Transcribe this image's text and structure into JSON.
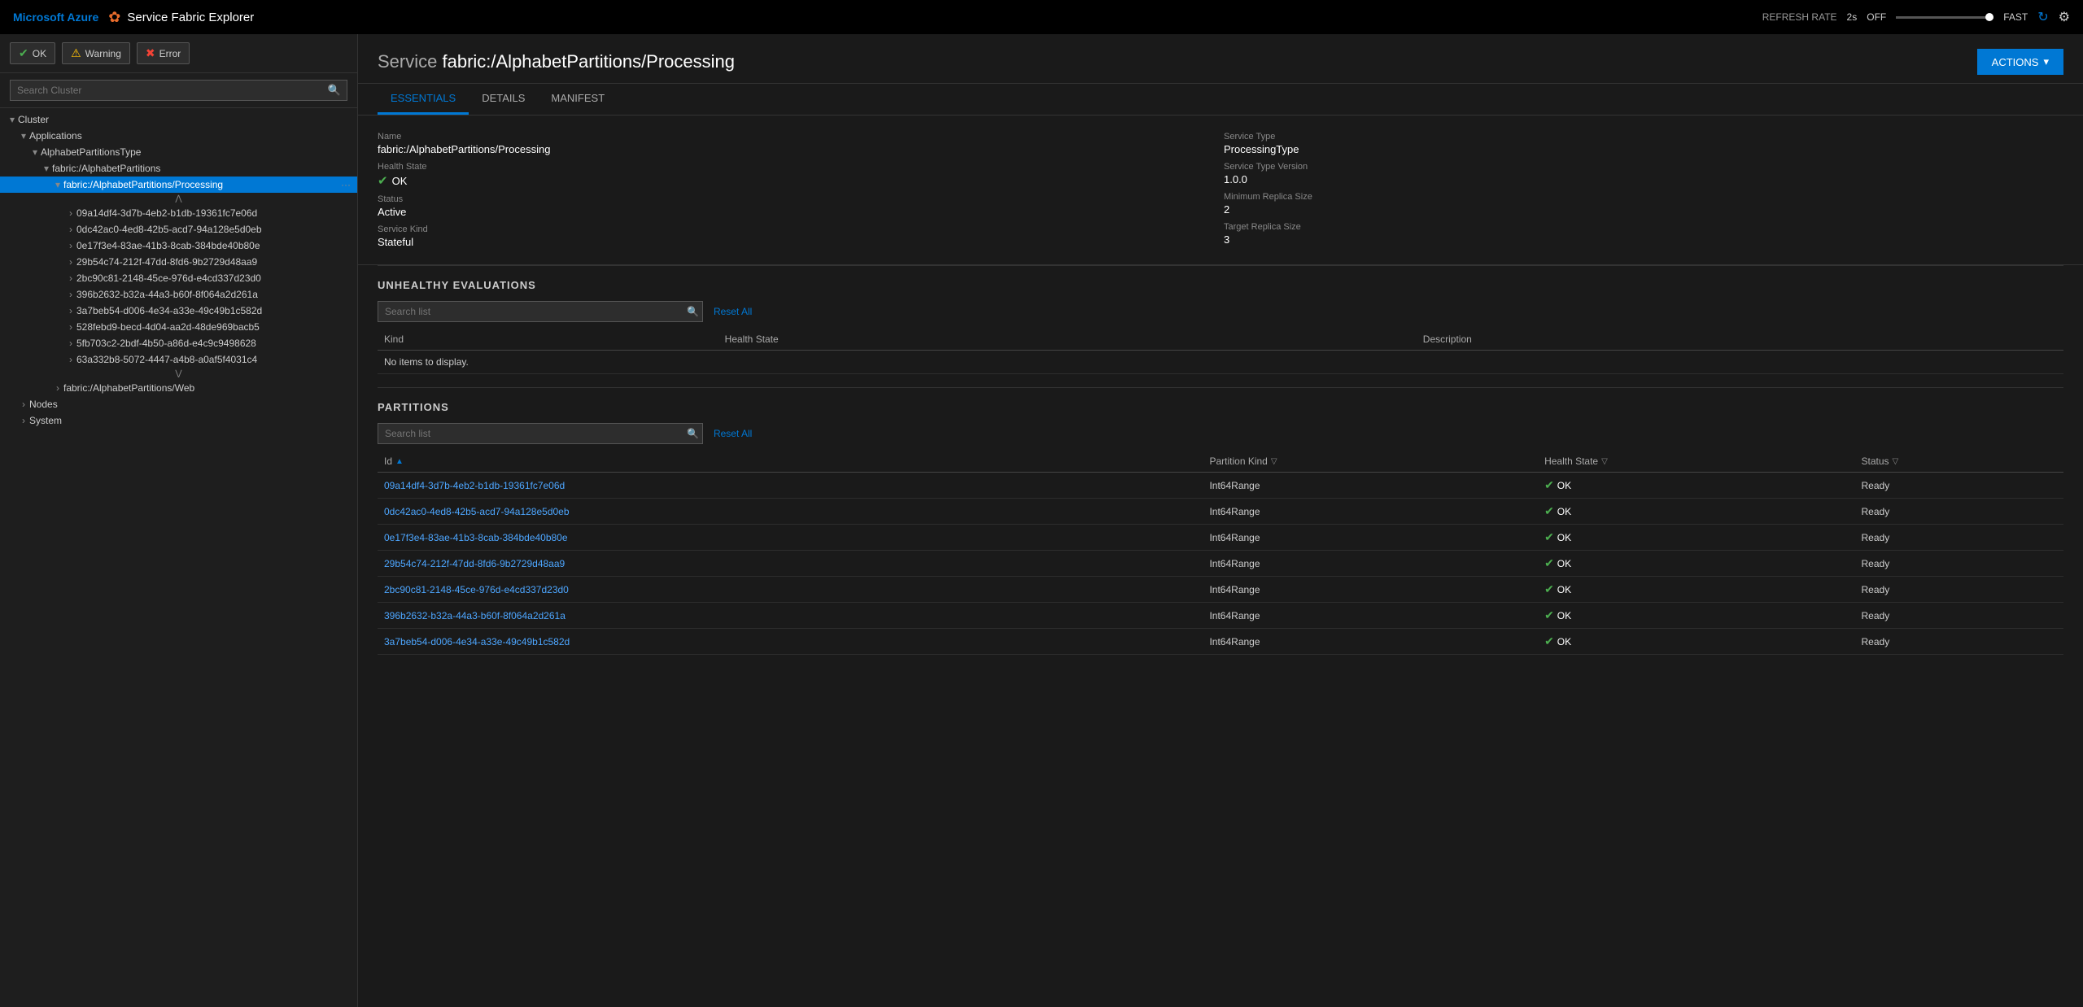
{
  "topNav": {
    "azure": "Microsoft Azure",
    "brand": "Service Fabric Explorer",
    "refreshRate": "REFRESH RATE",
    "refreshValue": "2s",
    "off": "OFF",
    "fast": "FAST"
  },
  "sidebar": {
    "searchPlaceholder": "Search Cluster",
    "buttons": [
      {
        "id": "ok",
        "label": "OK",
        "type": "ok"
      },
      {
        "id": "warning",
        "label": "Warning",
        "type": "warn"
      },
      {
        "id": "error",
        "label": "Error",
        "type": "err"
      }
    ],
    "tree": {
      "cluster": "Cluster",
      "applications": "Applications",
      "alphabetPartitionsType": "AlphabetPartitionsType",
      "fabricAlphabetPartitions": "fabric:/AlphabetPartitions",
      "selectedItem": "fabric:/AlphabetPartitions/Processing",
      "partitions": [
        "09a14df4-3d7b-4eb2-b1db-19361fc7e06d",
        "0dc42ac0-4ed8-42b5-acd7-94a128e5d0eb",
        "0e17f3e4-83ae-41b3-8cab-384bde40b80e",
        "29b54c74-212f-47dd-8fd6-9b2729d48aa9",
        "2bc90c81-2148-45ce-976d-e4cd337d23d0",
        "396b2632-b32a-44a3-b60f-8f064a2d261a",
        "3a7beb54-d006-4e34-a33e-49c49b1c582d",
        "528febd9-becd-4d04-aa2d-48de969bacb5",
        "5fb703c2-2bdf-4b50-a86d-e4c9c9498628",
        "63a332b8-5072-4447-a4b8-a0af5f4031c4"
      ],
      "fabricAlphabetPartitionsWeb": "fabric:/AlphabetPartitions/Web",
      "nodes": "Nodes",
      "system": "System"
    }
  },
  "service": {
    "label": "Service",
    "name": "fabric:/AlphabetPartitions/Processing",
    "actionsLabel": "ACTIONS",
    "tabs": [
      "ESSENTIALS",
      "DETAILS",
      "MANIFEST"
    ],
    "activeTab": "ESSENTIALS",
    "essentials": {
      "nameLabel": "Name",
      "nameValue": "fabric:/AlphabetPartitions/Processing",
      "healthStateLabel": "Health State",
      "healthStateValue": "OK",
      "statusLabel": "Status",
      "statusValue": "Active",
      "serviceKindLabel": "Service Kind",
      "serviceKindValue": "Stateful",
      "serviceTypeLabel": "Service Type",
      "serviceTypeValue": "ProcessingType",
      "serviceTypeVersionLabel": "Service Type Version",
      "serviceTypeVersionValue": "1.0.0",
      "minReplicaSizeLabel": "Minimum Replica Size",
      "minReplicaSizeValue": "2",
      "targetReplicaSizeLabel": "Target Replica Size",
      "targetReplicaSizeValue": "3"
    },
    "unhealthyEvaluations": {
      "title": "UNHEALTHY EVALUATIONS",
      "searchPlaceholder": "Search list",
      "resetAll": "Reset All",
      "columns": [
        "Kind",
        "Health State",
        "Description"
      ],
      "noItems": "No items to display."
    },
    "partitions": {
      "title": "PARTITIONS",
      "searchPlaceholder": "Search list",
      "resetAll": "Reset All",
      "columns": [
        "Id",
        "Partition Kind",
        "Health State",
        "Status"
      ],
      "rows": [
        {
          "id": "09a14df4-3d7b-4eb2-b1db-19361fc7e06d",
          "kind": "Int64Range",
          "health": "OK",
          "status": "Ready"
        },
        {
          "id": "0dc42ac0-4ed8-42b5-acd7-94a128e5d0eb",
          "kind": "Int64Range",
          "health": "OK",
          "status": "Ready"
        },
        {
          "id": "0e17f3e4-83ae-41b3-8cab-384bde40b80e",
          "kind": "Int64Range",
          "health": "OK",
          "status": "Ready"
        },
        {
          "id": "29b54c74-212f-47dd-8fd6-9b2729d48aa9",
          "kind": "Int64Range",
          "health": "OK",
          "status": "Ready"
        },
        {
          "id": "2bc90c81-2148-45ce-976d-e4cd337d23d0",
          "kind": "Int64Range",
          "health": "OK",
          "status": "Ready"
        },
        {
          "id": "396b2632-b32a-44a3-b60f-8f064a2d261a",
          "kind": "Int64Range",
          "health": "OK",
          "status": "Ready"
        },
        {
          "id": "3a7beb54-d006-4e34-a33e-49c49b1c582d",
          "kind": "Int64Range",
          "health": "OK",
          "status": "Ready"
        }
      ]
    }
  }
}
